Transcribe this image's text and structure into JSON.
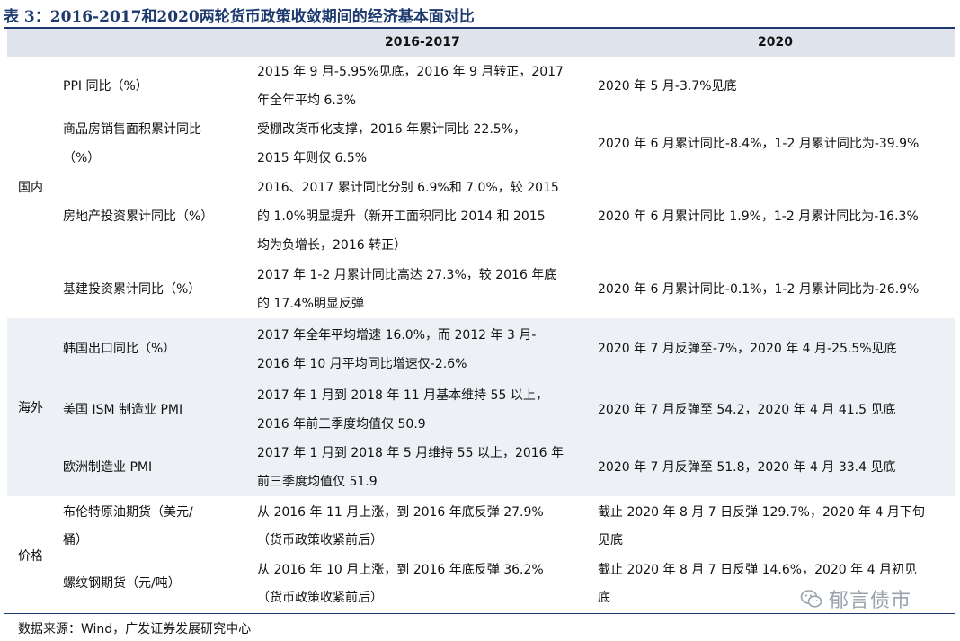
{
  "title": "表 3：2016-2017和2020两轮货币政策收敛期间的经济基本面对比",
  "headers": {
    "col_2016": "2016-2017",
    "col_2020": "2020"
  },
  "categories": {
    "domestic": "国内",
    "overseas": "海外",
    "price": "价格"
  },
  "rows": [
    {
      "label": [
        "PPI 同比（%）"
      ],
      "y2016": [
        "2015 年 9 月-5.95%见底，2016 年 9 月转正，2017",
        "年全年平均 6.3%"
      ],
      "y2020": [
        "2020 年 5 月-3.7%见底"
      ]
    },
    {
      "label": [
        "商品房销售面积累计同比",
        "（%）"
      ],
      "y2016": [
        "受棚改货币化支撑，2016 年累计同比 22.5%，",
        "2015 年则仅 6.5%"
      ],
      "y2020": [
        "2020 年 6 月累计同比-8.4%，1-2 月累计同比为-39.9%"
      ]
    },
    {
      "label": [
        "房地产投资累计同比（%）"
      ],
      "y2016": [
        "2016、2017 累计同比分别 6.9%和 7.0%，较 2015",
        "的 1.0%明显提升（新开工面积同比 2014 和 2015",
        "均为负增长，2016 转正）"
      ],
      "y2020": [
        "2020 年 6 月累计同比 1.9%，1-2 月累计同比为-16.3%"
      ]
    },
    {
      "label": [
        "基建投资累计同比（%）"
      ],
      "y2016": [
        "2017 年 1-2 月累计同比高达 27.3%，较 2016 年底",
        "的 17.4%明显反弹"
      ],
      "y2020": [
        "2020 年 6 月累计同比-0.1%，1-2 月累计同比为-26.9%"
      ]
    },
    {
      "label": [
        "韩国出口同比（%）"
      ],
      "y2016": [
        "2017 年全年平均增速 16.0%，而 2012 年 3 月-",
        "2016 年 10 月平均同比增速仅-2.6%"
      ],
      "y2020": [
        "2020 年 7 月反弹至-7%，2020 年 4 月-25.5%见底"
      ]
    },
    {
      "label": [
        "美国 ISM 制造业 PMI"
      ],
      "y2016": [
        "2017 年 1 月到 2018 年 11 月基本维持 55 以上，",
        "2016 年前三季度均值仅 50.9"
      ],
      "y2020": [
        "2020 年 7 月反弹至 54.2，2020 年 4 月 41.5 见底"
      ]
    },
    {
      "label": [
        "欧洲制造业 PMI"
      ],
      "y2016": [
        "2017 年 1 月到 2018 年 5 月维持 55 以上，2016 年",
        "前三季度均值仅 51.9"
      ],
      "y2020": [
        "2020 年 7 月反弹至 51.8，2020 年 4 月 33.4 见底"
      ]
    },
    {
      "label": [
        "布伦特原油期货（美元/",
        "桶）"
      ],
      "y2016": [
        "从 2016 年 11 月上涨，到 2016 年底反弹 27.9%",
        "（货币政策收紧前后）"
      ],
      "y2020": [
        "截止 2020 年 8 月 7 日反弹 129.7%，2020 年 4 月下旬",
        "见底"
      ]
    },
    {
      "label": [
        "螺纹钢期货（元/吨）"
      ],
      "y2016": [
        "从 2016 年 10 月上涨，到 2016 年底反弹 36.2%",
        "（货币政策收紧前后）"
      ],
      "y2020": [
        "截止 2020 年 8 月 7 日反弹 14.6%，2020 年 4 月初见",
        "底"
      ]
    }
  ],
  "source": "数据来源：Wind，广发证券发展研究中心",
  "watermark": {
    "text": "郁言债市",
    "icon": "wechat-icon"
  },
  "colors": {
    "title": "#1d3a6e",
    "header_bg": "#dfe4ec",
    "band_bg": "#edf0f5"
  }
}
